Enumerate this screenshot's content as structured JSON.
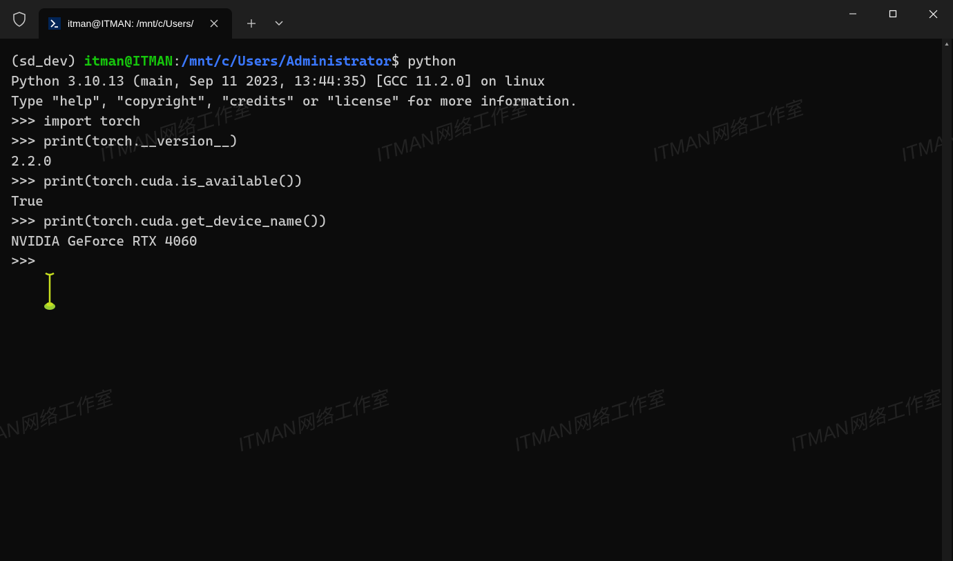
{
  "titlebar": {
    "tab_title": "itman@ITMAN: /mnt/c/Users/"
  },
  "prompt": {
    "env": "(sd_dev)",
    "user_host": "itman@ITMAN",
    "colon": ":",
    "path": "/mnt/c/Users/Administrator",
    "dollar": "$",
    "command": "python"
  },
  "terminal": {
    "lines": [
      "Python 3.10.13 (main, Sep 11 2023, 13:44:35) [GCC 11.2.0] on linux",
      "Type \"help\", \"copyright\", \"credits\" or \"license\" for more information.",
      ">>> import torch",
      ">>> print(torch.__version__)",
      "2.2.0",
      ">>> print(torch.cuda.is_available())",
      "True",
      ">>> print(torch.cuda.get_device_name())",
      "NVIDIA GeForce RTX 4060",
      ">>> "
    ]
  },
  "watermark_text": "ITMAN网络工作室"
}
